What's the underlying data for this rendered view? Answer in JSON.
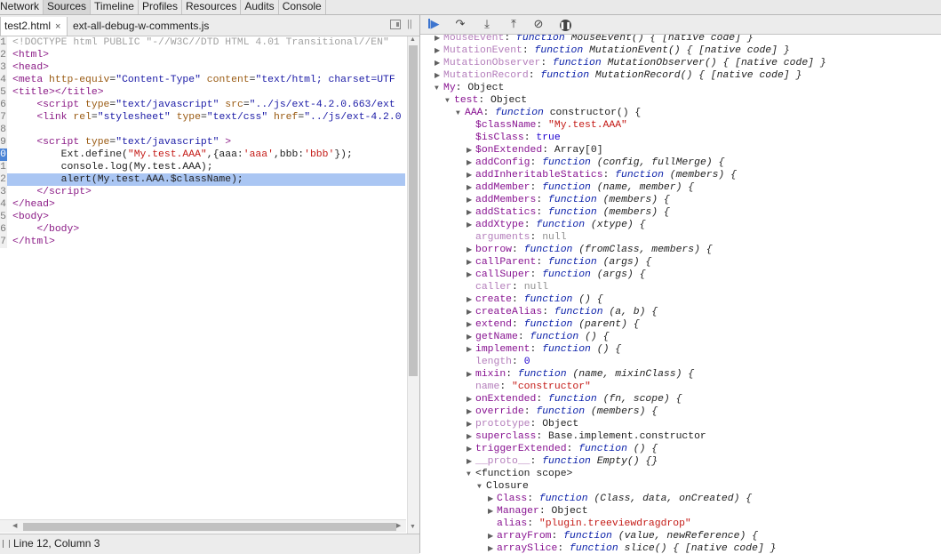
{
  "top_tabs": [
    "Network",
    "Sources",
    "Timeline",
    "Profiles",
    "Resources",
    "Audits",
    "Console"
  ],
  "file_tabs": [
    {
      "label": "test2.html",
      "close": "×"
    },
    {
      "label": "ext-all-debug-w-comments.js"
    }
  ],
  "code_lines": [
    {
      "n": "1",
      "html": "<span class=\"c-dt\">&lt;!DOCTYPE html PUBLIC \"-//W3C//DTD HTML 4.01 Transitional//EN\"</span>"
    },
    {
      "n": "2",
      "html": "<span class=\"c-tag\">&lt;html&gt;</span>"
    },
    {
      "n": "3",
      "html": "<span class=\"c-tag\">&lt;head&gt;</span>"
    },
    {
      "n": "4",
      "html": "<span class=\"c-tag\">&lt;meta</span> <span class=\"c-attr\">http-equiv</span>=<span class=\"c-str\">\"Content-Type\"</span> <span class=\"c-attr\">content</span>=<span class=\"c-str\">\"text/html; charset=UTF</span>"
    },
    {
      "n": "5",
      "html": "<span class=\"c-tag\">&lt;title&gt;&lt;/title&gt;</span>"
    },
    {
      "n": "6",
      "html": "    <span class=\"c-tag\">&lt;script</span> <span class=\"c-attr\">type</span>=<span class=\"c-str\">\"text/javascript\"</span> <span class=\"c-attr\">src</span>=<span class=\"c-str\">\"../js/ext-4.2.0.663/ext</span>"
    },
    {
      "n": "7",
      "html": "    <span class=\"c-tag\">&lt;link</span> <span class=\"c-attr\">rel</span>=<span class=\"c-str\">\"stylesheet\"</span> <span class=\"c-attr\">type</span>=<span class=\"c-str\">\"text/css\"</span> <span class=\"c-attr\">href</span>=<span class=\"c-str\">\"../js/ext-4.2.0</span>"
    },
    {
      "n": "8",
      "html": ""
    },
    {
      "n": "9",
      "html": "    <span class=\"c-tag\">&lt;script</span> <span class=\"c-attr\">type</span>=<span class=\"c-str\">\"text/javascript\"</span> <span class=\"c-tag\">&gt;</span>"
    },
    {
      "n": "0",
      "html": "        Ext.define(<span class=\"c-js-str\">\"My.test.AAA\"</span>,{aaa:<span class=\"c-js-str\">'aaa'</span>,bbb:<span class=\"c-js-str\">'bbb'</span>});",
      "bp": true
    },
    {
      "n": "1",
      "html": "        console.log(My.test.AAA);"
    },
    {
      "n": "2",
      "html": "        alert(My.test.AAA.$className);",
      "hl": true
    },
    {
      "n": "3",
      "html": "    <span class=\"c-tag\">&lt;/script&gt;</span>"
    },
    {
      "n": "4",
      "html": "<span class=\"c-tag\">&lt;/head&gt;</span>"
    },
    {
      "n": "5",
      "html": "<span class=\"c-tag\">&lt;body&gt;</span>"
    },
    {
      "n": "6",
      "html": "    <span class=\"c-tag\">&lt;/body&gt;</span>"
    },
    {
      "n": "7",
      "html": "<span class=\"c-tag\">&lt;/html&gt;</span>"
    }
  ],
  "status_text": "Line 12, Column 3",
  "tree_lines": [
    {
      "d": 0,
      "t": "r",
      "html": "<span class=\"k-gray\">MouseEvent</span>: <span class=\"fn\">function</span> <span class=\"sig\">MouseEvent() { [native code] }</span>"
    },
    {
      "d": 0,
      "t": "r",
      "html": "<span class=\"k-gray\">MutationEvent</span>: <span class=\"fn\">function</span> <span class=\"sig\">MutationEvent() { [native code] }</span>"
    },
    {
      "d": 0,
      "t": "r",
      "html": "<span class=\"k-gray\">MutationObserver</span>: <span class=\"fn\">function</span> <span class=\"sig\">MutationObserver() { [native code] }</span>"
    },
    {
      "d": 0,
      "t": "r",
      "html": "<span class=\"k-gray\">MutationRecord</span>: <span class=\"fn\">function</span> <span class=\"sig\">MutationRecord() { [native code] }</span>"
    },
    {
      "d": 0,
      "t": "d",
      "html": "<span class=\"k\">My</span>: <span class=\"plain\">Object</span>"
    },
    {
      "d": 1,
      "t": "d",
      "html": "<span class=\"k\">test</span>: <span class=\"plain\">Object</span>"
    },
    {
      "d": 2,
      "t": "d",
      "html": "<span class=\"k\">AAA</span>: <span class=\"fn\">function</span> <span class=\"plain\">constructor() {</span>"
    },
    {
      "d": 3,
      "t": "n",
      "html": "<span class=\"k\">$className</span>: <span class=\"str\">\"My.test.AAA\"</span>"
    },
    {
      "d": 3,
      "t": "n",
      "html": "<span class=\"k\">$isClass</span>: <span class=\"num\">true</span>"
    },
    {
      "d": 3,
      "t": "r",
      "html": "<span class=\"k\">$onExtended</span>: <span class=\"plain\">Array[0]</span>"
    },
    {
      "d": 3,
      "t": "r",
      "html": "<span class=\"k\">addConfig</span>: <span class=\"fn\">function</span> <span class=\"sig\">(config, fullMerge) {</span>"
    },
    {
      "d": 3,
      "t": "r",
      "html": "<span class=\"k\">addInheritableStatics</span>: <span class=\"fn\">function</span> <span class=\"sig\">(members) {</span>"
    },
    {
      "d": 3,
      "t": "r",
      "html": "<span class=\"k\">addMember</span>: <span class=\"fn\">function</span> <span class=\"sig\">(name, member) {</span>"
    },
    {
      "d": 3,
      "t": "r",
      "html": "<span class=\"k\">addMembers</span>: <span class=\"fn\">function</span> <span class=\"sig\">(members) {</span>"
    },
    {
      "d": 3,
      "t": "r",
      "html": "<span class=\"k\">addStatics</span>: <span class=\"fn\">function</span> <span class=\"sig\">(members) {</span>"
    },
    {
      "d": 3,
      "t": "r",
      "html": "<span class=\"k\">addXtype</span>: <span class=\"fn\">function</span> <span class=\"sig\">(xtype) {</span>"
    },
    {
      "d": 3,
      "t": "n",
      "html": "<span class=\"k-gray\">arguments</span>: <span class=\"dim\">null</span>"
    },
    {
      "d": 3,
      "t": "r",
      "html": "<span class=\"k\">borrow</span>: <span class=\"fn\">function</span> <span class=\"sig\">(fromClass, members) {</span>"
    },
    {
      "d": 3,
      "t": "r",
      "html": "<span class=\"k\">callParent</span>: <span class=\"fn\">function</span> <span class=\"sig\">(args) {</span>"
    },
    {
      "d": 3,
      "t": "r",
      "html": "<span class=\"k\">callSuper</span>: <span class=\"fn\">function</span> <span class=\"sig\">(args) {</span>"
    },
    {
      "d": 3,
      "t": "n",
      "html": "<span class=\"k-gray\">caller</span>: <span class=\"dim\">null</span>"
    },
    {
      "d": 3,
      "t": "r",
      "html": "<span class=\"k\">create</span>: <span class=\"fn\">function</span> <span class=\"sig\">() {</span>"
    },
    {
      "d": 3,
      "t": "r",
      "html": "<span class=\"k\">createAlias</span>: <span class=\"fn\">function</span> <span class=\"sig\">(a, b) {</span>"
    },
    {
      "d": 3,
      "t": "r",
      "html": "<span class=\"k\">extend</span>: <span class=\"fn\">function</span> <span class=\"sig\">(parent) {</span>"
    },
    {
      "d": 3,
      "t": "r",
      "html": "<span class=\"k\">getName</span>: <span class=\"fn\">function</span> <span class=\"sig\">() {</span>"
    },
    {
      "d": 3,
      "t": "r",
      "html": "<span class=\"k\">implement</span>: <span class=\"fn\">function</span> <span class=\"sig\">() {</span>"
    },
    {
      "d": 3,
      "t": "n",
      "html": "<span class=\"k-gray\">length</span>: <span class=\"num\">0</span>"
    },
    {
      "d": 3,
      "t": "r",
      "html": "<span class=\"k\">mixin</span>: <span class=\"fn\">function</span> <span class=\"sig\">(name, mixinClass) {</span>"
    },
    {
      "d": 3,
      "t": "n",
      "html": "<span class=\"k-gray\">name</span>: <span class=\"str\">\"constructor\"</span>"
    },
    {
      "d": 3,
      "t": "r",
      "html": "<span class=\"k\">onExtended</span>: <span class=\"fn\">function</span> <span class=\"sig\">(fn, scope) {</span>"
    },
    {
      "d": 3,
      "t": "r",
      "html": "<span class=\"k\">override</span>: <span class=\"fn\">function</span> <span class=\"sig\">(members) {</span>"
    },
    {
      "d": 3,
      "t": "r",
      "html": "<span class=\"k-gray\">prototype</span>: <span class=\"plain\">Object</span>"
    },
    {
      "d": 3,
      "t": "r",
      "html": "<span class=\"k\">superclass</span>: <span class=\"plain\">Base.implement.constructor</span>"
    },
    {
      "d": 3,
      "t": "r",
      "html": "<span class=\"k\">triggerExtended</span>: <span class=\"fn\">function</span> <span class=\"sig\">() {</span>"
    },
    {
      "d": 3,
      "t": "r",
      "html": "<span class=\"k-gray\">__proto__</span>: <span class=\"fn\">function</span> <span class=\"sig\">Empty() {}</span>"
    },
    {
      "d": 3,
      "t": "d",
      "html": "<span class=\"plain\">&lt;function scope&gt;</span>"
    },
    {
      "d": 4,
      "t": "d",
      "html": "<span class=\"plain\">Closure</span>"
    },
    {
      "d": 5,
      "t": "r",
      "html": "<span class=\"k\">Class</span>: <span class=\"fn\">function</span> <span class=\"sig\">(Class, data, onCreated) {</span>"
    },
    {
      "d": 5,
      "t": "r",
      "html": "<span class=\"k\">Manager</span>: <span class=\"plain\">Object</span>"
    },
    {
      "d": 5,
      "t": "n",
      "html": "<span class=\"k\">alias</span>: <span class=\"str\">\"plugin.treeviewdragdrop\"</span>"
    },
    {
      "d": 5,
      "t": "r",
      "html": "<span class=\"k\">arrayFrom</span>: <span class=\"fn\">function</span> <span class=\"sig\">(value, newReference) {</span>"
    },
    {
      "d": 5,
      "t": "r",
      "html": "<span class=\"k\">arraySlice</span>: <span class=\"fn\">function</span> <span class=\"sig\">slice() { [native code] }</span>"
    }
  ]
}
